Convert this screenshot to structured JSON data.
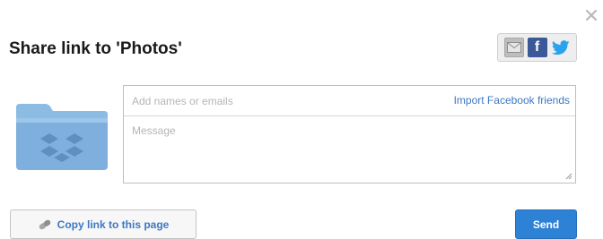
{
  "dialog": {
    "title": "Share link to 'Photos'",
    "close_icon": "close-icon"
  },
  "share_tabs": [
    {
      "name": "email",
      "icon": "email-icon"
    },
    {
      "name": "facebook",
      "icon": "facebook-icon",
      "glyph": "f"
    },
    {
      "name": "twitter",
      "icon": "twitter-icon"
    }
  ],
  "folder": {
    "icon": "dropbox-folder-icon"
  },
  "form": {
    "recipients_placeholder": "Add names or emails",
    "recipients_value": "",
    "import_link": "Import Facebook friends",
    "message_placeholder": "Message",
    "message_value": ""
  },
  "footer": {
    "copy_link_label": "Copy link to this page",
    "copy_link_icon": "link-icon",
    "send_label": "Send"
  },
  "colors": {
    "accent": "#2e82d6",
    "link": "#3d78c2",
    "facebook": "#3b5998",
    "twitter": "#2aa3ef",
    "folder": "#7fb0dd"
  }
}
